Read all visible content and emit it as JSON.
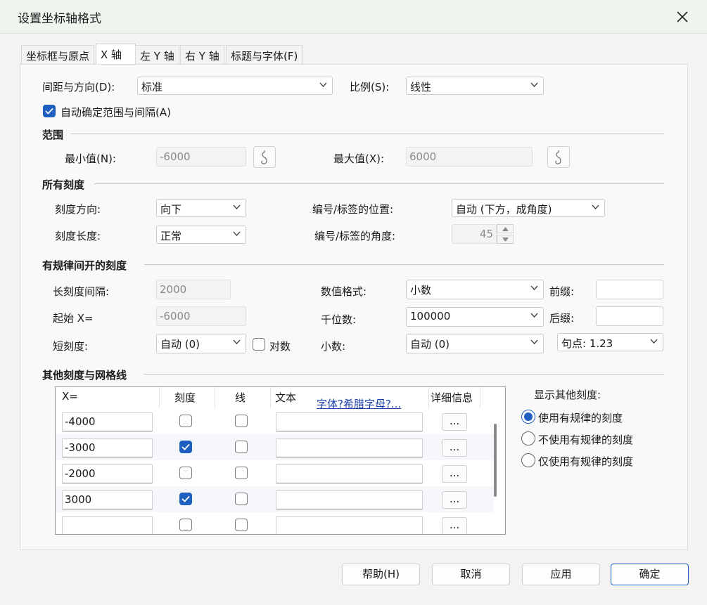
{
  "window": {
    "title": "设置坐标轴格式",
    "close_label": "✕"
  },
  "tabs": [
    {
      "label": "坐标框与原点"
    },
    {
      "label": "X 轴"
    },
    {
      "label": "左 Y 轴"
    },
    {
      "label": "右 Y 轴"
    },
    {
      "label": "标题与字体(F)"
    }
  ],
  "spacing": {
    "label": "间距与方向(D):",
    "value": "标准",
    "scale_label": "比例(S):",
    "scale_value": "线性",
    "auto_range_label": "自动确定范围与间隔(A)",
    "auto_range_checked": true
  },
  "range": {
    "title": "范围",
    "min_label": "最小值(N):",
    "min_value": "-6000",
    "max_label": "最大值(X):",
    "max_value": "6000"
  },
  "all_ticks": {
    "title": "所有刻度",
    "direction_label": "刻度方向:",
    "direction_value": "向下",
    "length_label": "刻度长度:",
    "length_value": "正常",
    "label_pos_label": "编号/标签的位置:",
    "label_pos_value": "自动 (下方，成角度)",
    "label_angle_label": "编号/标签的角度:",
    "label_angle_value": "45"
  },
  "regular_ticks": {
    "title": "有规律间开的刻度",
    "major_label": "长刻度间隔:",
    "major_value": "2000",
    "start_label": "起始 X=",
    "start_value": "-6000",
    "minor_label": "短刻度:",
    "minor_value": "自动 (0)",
    "log_label": "对数",
    "log_checked": false,
    "numfmt_label": "数值格式:",
    "numfmt_value": "小数",
    "thousands_label": "千位数:",
    "thousands_value": "100000",
    "decimals_label": "小数:",
    "decimals_value": "自动 (0)",
    "prefix_label": "前缀:",
    "prefix_value": "",
    "suffix_label": "后缀:",
    "suffix_value": "",
    "decimal_point_value": "句点: 1.23"
  },
  "other_ticks": {
    "title": "其他刻度与网格线",
    "columns": {
      "x": "X=",
      "tick": "刻度",
      "line": "线",
      "text": "文本",
      "font_link": "字体?希腊字母?...",
      "details": "详细信息"
    },
    "rows": [
      {
        "x": "-4000",
        "tick": false,
        "line": false,
        "text": "",
        "details": "..."
      },
      {
        "x": "-3000",
        "tick": true,
        "line": false,
        "text": "",
        "details": "..."
      },
      {
        "x": "-2000",
        "tick": false,
        "line": false,
        "text": "",
        "details": "..."
      },
      {
        "x": "3000",
        "tick": true,
        "line": false,
        "text": "",
        "details": "..."
      },
      {
        "x": "",
        "tick": false,
        "line": false,
        "text": "",
        "details": "..."
      }
    ],
    "show_label": "显示其他刻度:",
    "options": [
      {
        "label": "使用有规律的刻度",
        "selected": true
      },
      {
        "label": "不使用有规律的刻度",
        "selected": false
      },
      {
        "label": "仅使用有规律的刻度",
        "selected": false
      }
    ]
  },
  "footer": {
    "help": "帮助(H)",
    "cancel": "取消",
    "apply": "应用",
    "ok": "确定"
  },
  "colors": {
    "accent": "#1f5fbf",
    "titlebar": "#eef4ee",
    "panel": "#f9f9f9"
  }
}
